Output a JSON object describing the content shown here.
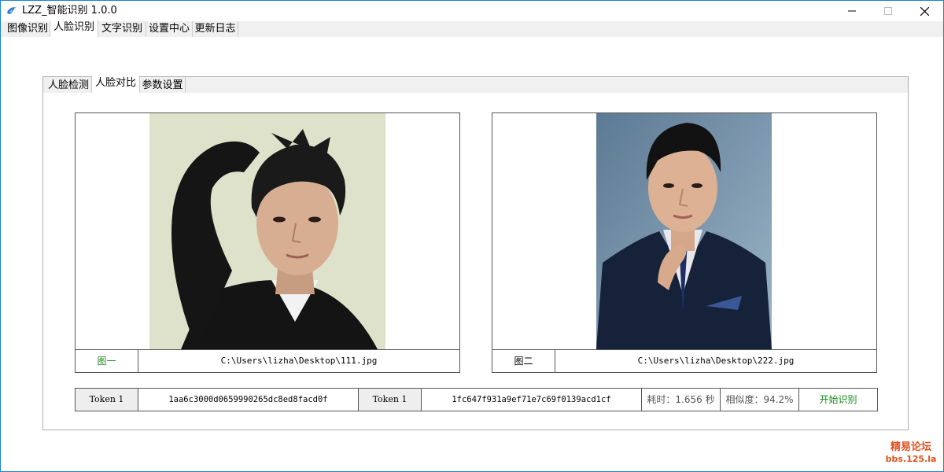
{
  "window": {
    "title": "LZZ_智能识别 1.0.0"
  },
  "menu": {
    "tabs": [
      {
        "label": "图像识别"
      },
      {
        "label": "人脸识别"
      },
      {
        "label": "文字识别"
      },
      {
        "label": "设置中心"
      },
      {
        "label": "更新日志"
      }
    ],
    "active_index": 1
  },
  "subtabs": {
    "tabs": [
      {
        "label": "人脸检测"
      },
      {
        "label": "人脸对比"
      },
      {
        "label": "参数设置"
      }
    ],
    "active_index": 1
  },
  "image1": {
    "label": "图一",
    "path": "C:\\Users\\lizha\\Desktop\\111.jpg",
    "label_color": "#1a8a1a"
  },
  "image2": {
    "label": "图二",
    "path": "C:\\Users\\lizha\\Desktop\\222.jpg"
  },
  "results": {
    "token1_label": "Token 1",
    "token1_value": "1aa6c3000d0659990265dc8ed8facd0f",
    "token2_label": "Token 1",
    "token2_value": "1fc647f931a9ef71e7c69f0139acd1cf",
    "time": "耗时：1.656 秒",
    "similarity": "相似度：94.2%",
    "start_button": "开始识别",
    "start_color": "#1a8a1a"
  },
  "watermark": {
    "line1": "精易论坛",
    "line2": "bbs.125.la"
  }
}
